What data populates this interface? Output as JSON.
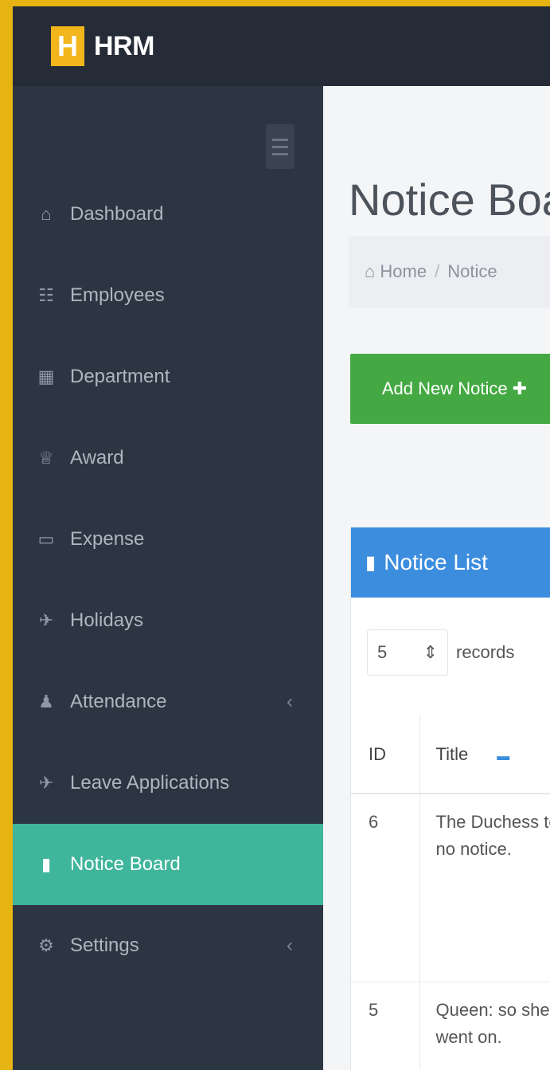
{
  "app": {
    "logo_letter": "H",
    "name": "HRM"
  },
  "sidebar": {
    "items": [
      {
        "icon": "dashboard-icon",
        "glyph": "⌂",
        "label": "Dashboard"
      },
      {
        "icon": "employees-icon",
        "glyph": "☷",
        "label": "Employees"
      },
      {
        "icon": "department-icon",
        "glyph": "▦",
        "label": "Department"
      },
      {
        "icon": "award-icon",
        "glyph": "♕",
        "label": "Award"
      },
      {
        "icon": "expense-icon",
        "glyph": "▭",
        "label": "Expense"
      },
      {
        "icon": "holidays-icon",
        "glyph": "✈",
        "label": "Holidays"
      },
      {
        "icon": "attendance-icon",
        "glyph": "♟",
        "label": "Attendance",
        "chevron": "‹"
      },
      {
        "icon": "leave-icon",
        "glyph": "✈",
        "label": "Leave Applications"
      },
      {
        "icon": "notice-icon",
        "glyph": "▮",
        "label": "Notice Board"
      },
      {
        "icon": "settings-icon",
        "glyph": "⚙",
        "label": "Settings",
        "chevron": "‹"
      }
    ]
  },
  "page": {
    "title": "Notice Board",
    "breadcrumb": {
      "home": "Home",
      "separator": "/",
      "current": "Notice"
    },
    "add_button": "Add New Notice ✚"
  },
  "panel": {
    "title": "Notice List",
    "records": {
      "value": "5",
      "label": "records"
    },
    "columns": {
      "id": "ID",
      "title": "Title"
    },
    "rows": [
      {
        "id": "6",
        "title": "The Duchess took no notice."
      },
      {
        "id": "5",
        "title": "Queen: so she went on."
      }
    ]
  },
  "colors": {
    "accent_active": "#3fb59b",
    "primary": "#3c8dde",
    "success": "#44a843",
    "logo": "#f2b51c",
    "sidebar_bg": "#2c3542"
  }
}
